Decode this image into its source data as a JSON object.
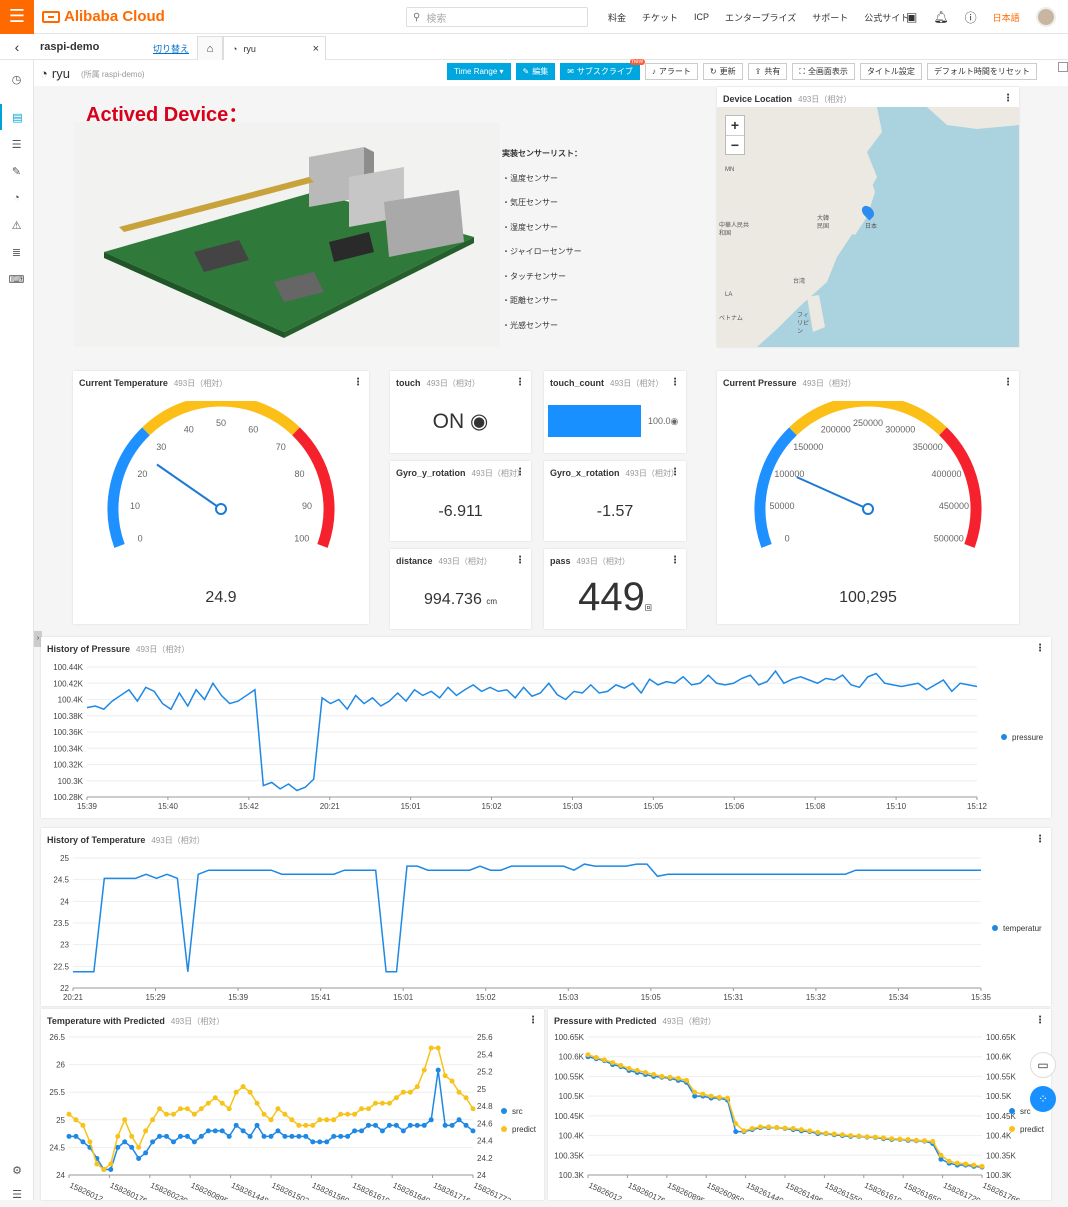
{
  "top": {
    "brand": "Alibaba Cloud",
    "search_placeholder": "検索",
    "nav": [
      "料金",
      "チケット",
      "ICP",
      "エンタープライズ",
      "サポート",
      "公式サイト"
    ],
    "lang": "日本語"
  },
  "project": {
    "name": "raspi-demo",
    "switch": "切り替え"
  },
  "tabs": {
    "current": "ryu"
  },
  "dashboard": {
    "title": "ryu",
    "belongs": "(所属 raspi-demo)"
  },
  "toolbar": [
    "Time Range ▾",
    "編集",
    "サブスクライブ",
    "アラート",
    "更新",
    "共有",
    "全画面表示",
    "タイトル設定",
    "デフォルト時間をリセット"
  ],
  "toolbar_new": "new",
  "rel": "493日（相対）",
  "device": {
    "heading": "Actived Device：",
    "list_title": "実装センサーリスト：",
    "sensors": [
      "・温度センサー",
      "・気圧センサー",
      "・湿度センサー",
      "・ジャイローセンサー",
      "・タッチセンサー",
      "・距離センサー",
      "・光感センサー"
    ]
  },
  "map": {
    "title": "Device Location",
    "labels": [
      "MN",
      "中華人民共和国",
      "大韓民国",
      "日本",
      "台湾",
      "フィリピン",
      "LA",
      "ベトナム"
    ]
  },
  "temp_gauge": {
    "title": "Current Temperature",
    "value": 24.9,
    "display": "24.9",
    "min": 0,
    "max": 100,
    "ticks": [
      "0",
      "10",
      "20",
      "30",
      "40",
      "50",
      "60",
      "70",
      "80",
      "90",
      "100"
    ]
  },
  "pressure_gauge": {
    "title": "Current Pressure",
    "value": 100295,
    "display": "100,295",
    "min": 0,
    "max": 500000,
    "ticks": [
      "0",
      "50000",
      "100000",
      "150000",
      "200000",
      "250000",
      "300000",
      "350000",
      "400000",
      "450000",
      "500000"
    ]
  },
  "touch": {
    "title": "touch",
    "value": "ON ◉"
  },
  "touch_count": {
    "title": "touch_count",
    "value": "100.0◉",
    "fill": 1.0
  },
  "gyro_y": {
    "title": "Gyro_y_rotation",
    "value": "-6.911"
  },
  "gyro_x": {
    "title": "Gyro_x_rotation",
    "value": "-1.57"
  },
  "distance": {
    "title": "distance",
    "value": "994.736",
    "unit": "cm"
  },
  "pass": {
    "title": "pass",
    "value": "449",
    "unit": "回"
  },
  "chart_data": [
    {
      "type": "line",
      "title": "History of Pressure",
      "x_ticks": [
        "15:39",
        "15:40",
        "15:42",
        "20:21",
        "15:01",
        "15:02",
        "15:03",
        "15:05",
        "15:06",
        "15:08",
        "15:10",
        "15:12"
      ],
      "y_ticks": [
        "100.28K",
        "100.3K",
        "100.32K",
        "100.34K",
        "100.36K",
        "100.38K",
        "100.4K",
        "100.42K",
        "100.44K"
      ],
      "ylim": [
        100280,
        100440
      ],
      "series": [
        {
          "name": "pressure",
          "values": [
            100390,
            100392,
            100388,
            100398,
            100405,
            100412,
            100398,
            100415,
            100410,
            100395,
            100388,
            100408,
            100392,
            100412,
            100400,
            100420,
            100405,
            100395,
            100398,
            100405,
            100412,
            100294,
            100298,
            100290,
            100296,
            100288,
            100292,
            100302,
            100402,
            100395,
            100400,
            100388,
            100405,
            100395,
            100402,
            100392,
            100398,
            100408,
            100398,
            100412,
            100405,
            100410,
            100402,
            100415,
            100405,
            100412,
            100418,
            100410,
            100415,
            100410,
            100412,
            100402,
            100415,
            100404,
            100408,
            100420,
            100406,
            100400,
            100410,
            100408,
            100418,
            100408,
            100410,
            100418,
            100414,
            100420,
            100408,
            100425,
            100418,
            100422,
            100420,
            100428,
            100418,
            100420,
            100430,
            100420,
            100418,
            100420,
            100426,
            100430,
            100418,
            100422,
            100435,
            100420,
            100425,
            100428,
            100424,
            100420,
            100426,
            100424,
            100430,
            100418,
            100415,
            100428,
            100432,
            100420,
            100418,
            100416,
            100418,
            100420,
            100412,
            100418,
            100424,
            100410,
            100420,
            100418,
            100416
          ]
        }
      ]
    },
    {
      "type": "line",
      "title": "History of Temperature",
      "x_ticks": [
        "20:21",
        "15:29",
        "15:39",
        "15:41",
        "15:01",
        "15:02",
        "15:03",
        "15:05",
        "15:31",
        "15:32",
        "15:34",
        "15:35"
      ],
      "y_ticks": [
        "22",
        "22.5",
        "23",
        "23.5",
        "24",
        "24.5",
        "25"
      ],
      "ylim": [
        22,
        25.2
      ],
      "series": [
        {
          "name": "temperatur",
          "values": [
            22.4,
            22.4,
            22.4,
            24.7,
            24.7,
            24.7,
            24.7,
            24.8,
            24.7,
            24.8,
            24.7,
            22.4,
            24.8,
            24.9,
            24.9,
            24.9,
            24.9,
            24.9,
            24.9,
            24.9,
            24.8,
            24.8,
            24.8,
            24.8,
            24.8,
            24.8,
            24.9,
            24.9,
            24.9,
            24.9,
            22.4,
            22.4,
            25.0,
            25.0,
            24.9,
            24.9,
            24.9,
            24.9,
            24.9,
            25.0,
            24.9,
            24.9,
            25.0,
            25.0,
            25.0,
            25.0,
            25.0,
            25.0,
            24.9,
            25.05,
            25.0,
            25.0,
            25.0,
            25.0,
            25.05,
            25.05,
            24.75,
            24.8,
            24.8,
            24.8,
            24.8,
            24.8,
            24.8,
            24.8,
            24.8,
            24.8,
            24.8,
            24.8,
            24.8,
            24.8,
            24.8,
            24.8,
            24.8,
            24.8,
            24.8,
            24.9,
            24.9,
            24.9,
            24.9,
            24.9,
            24.9,
            24.9,
            24.9,
            24.9,
            24.9,
            24.9,
            24.9,
            24.9
          ]
        }
      ]
    },
    {
      "type": "line",
      "title": "Temperature with Predicted",
      "x_ticks": [
        "15826012",
        "158260176",
        "158260230",
        "158260895",
        "158261448",
        "158261502",
        "158261560",
        "158261610",
        "158261640",
        "158261716",
        "158261772"
      ],
      "y_ticks_left": [
        "24",
        "24.5",
        "25",
        "25.5",
        "26",
        "26.5"
      ],
      "y_ticks_right": [
        "24",
        "24.2",
        "24.4",
        "24.6",
        "24.8",
        "25",
        "25.2",
        "25.4",
        "25.6"
      ],
      "ylim": [
        24,
        26.5
      ],
      "series": [
        {
          "name": "src",
          "values": [
            24.7,
            24.7,
            24.6,
            24.5,
            24.3,
            24.1,
            24.1,
            24.5,
            24.6,
            24.5,
            24.3,
            24.4,
            24.6,
            24.7,
            24.7,
            24.6,
            24.7,
            24.7,
            24.6,
            24.7,
            24.8,
            24.8,
            24.8,
            24.7,
            24.9,
            24.8,
            24.7,
            24.9,
            24.7,
            24.7,
            24.8,
            24.7,
            24.7,
            24.7,
            24.7,
            24.6,
            24.6,
            24.6,
            24.7,
            24.7,
            24.7,
            24.8,
            24.8,
            24.9,
            24.9,
            24.8,
            24.9,
            24.9,
            24.8,
            24.9,
            24.9,
            24.9,
            25.0,
            25.9,
            24.9,
            24.9,
            25.0,
            24.9,
            24.8
          ]
        },
        {
          "name": "predict",
          "values": [
            25.1,
            25.0,
            24.9,
            24.6,
            24.2,
            24.1,
            24.2,
            24.7,
            25.0,
            24.7,
            24.5,
            24.8,
            25.0,
            25.2,
            25.1,
            25.1,
            25.2,
            25.2,
            25.1,
            25.2,
            25.3,
            25.4,
            25.3,
            25.2,
            25.5,
            25.6,
            25.5,
            25.3,
            25.1,
            25.0,
            25.2,
            25.1,
            25.0,
            24.9,
            24.9,
            24.9,
            25.0,
            25.0,
            25.0,
            25.1,
            25.1,
            25.1,
            25.2,
            25.2,
            25.3,
            25.3,
            25.3,
            25.4,
            25.5,
            25.5,
            25.6,
            25.9,
            26.3,
            26.3,
            25.8,
            25.7,
            25.5,
            25.4,
            25.2
          ]
        }
      ]
    },
    {
      "type": "line",
      "title": "Pressure with Predicted",
      "x_ticks": [
        "15826012",
        "158260176",
        "158260895",
        "158260950",
        "158261440",
        "158261496",
        "158261550",
        "158261610",
        "158261650",
        "158261720",
        "158261766"
      ],
      "y_ticks_left": [
        "100.3K",
        "100.35K",
        "100.4K",
        "100.45K",
        "100.5K",
        "100.55K",
        "100.6K",
        "100.65K"
      ],
      "y_ticks_right": [
        "100.3K",
        "100.35K",
        "100.4K",
        "100.45K",
        "100.5K",
        "100.55K",
        "100.6K",
        "100.65K"
      ],
      "ylim": [
        100300,
        100650
      ],
      "series": [
        {
          "name": "src",
          "values": [
            100600,
            100595,
            100590,
            100580,
            100575,
            100565,
            100560,
            100555,
            100550,
            100548,
            100545,
            100540,
            100535,
            100500,
            100500,
            100495,
            100495,
            100490,
            100410,
            100410,
            100415,
            100420,
            100420,
            100420,
            100418,
            100415,
            100412,
            100410,
            100405,
            100405,
            100402,
            100400,
            100398,
            100398,
            100396,
            100395,
            100392,
            100390,
            100390,
            100388,
            100387,
            100386,
            100380,
            100340,
            100330,
            100325,
            100325,
            100322,
            100320
          ]
        },
        {
          "name": "predict",
          "values": [
            100605,
            100598,
            100592,
            100585,
            100578,
            100570,
            100565,
            100560,
            100555,
            100550,
            100548,
            100545,
            100540,
            100510,
            100505,
            100500,
            100497,
            100495,
            100430,
            100412,
            100418,
            100422,
            100422,
            100420,
            100419,
            100418,
            100415,
            100412,
            100408,
            100406,
            100404,
            100402,
            100400,
            100399,
            100397,
            100396,
            100394,
            100392,
            100391,
            100390,
            100388,
            100387,
            100385,
            100350,
            100335,
            100330,
            100328,
            100325,
            100322
          ]
        }
      ]
    }
  ]
}
